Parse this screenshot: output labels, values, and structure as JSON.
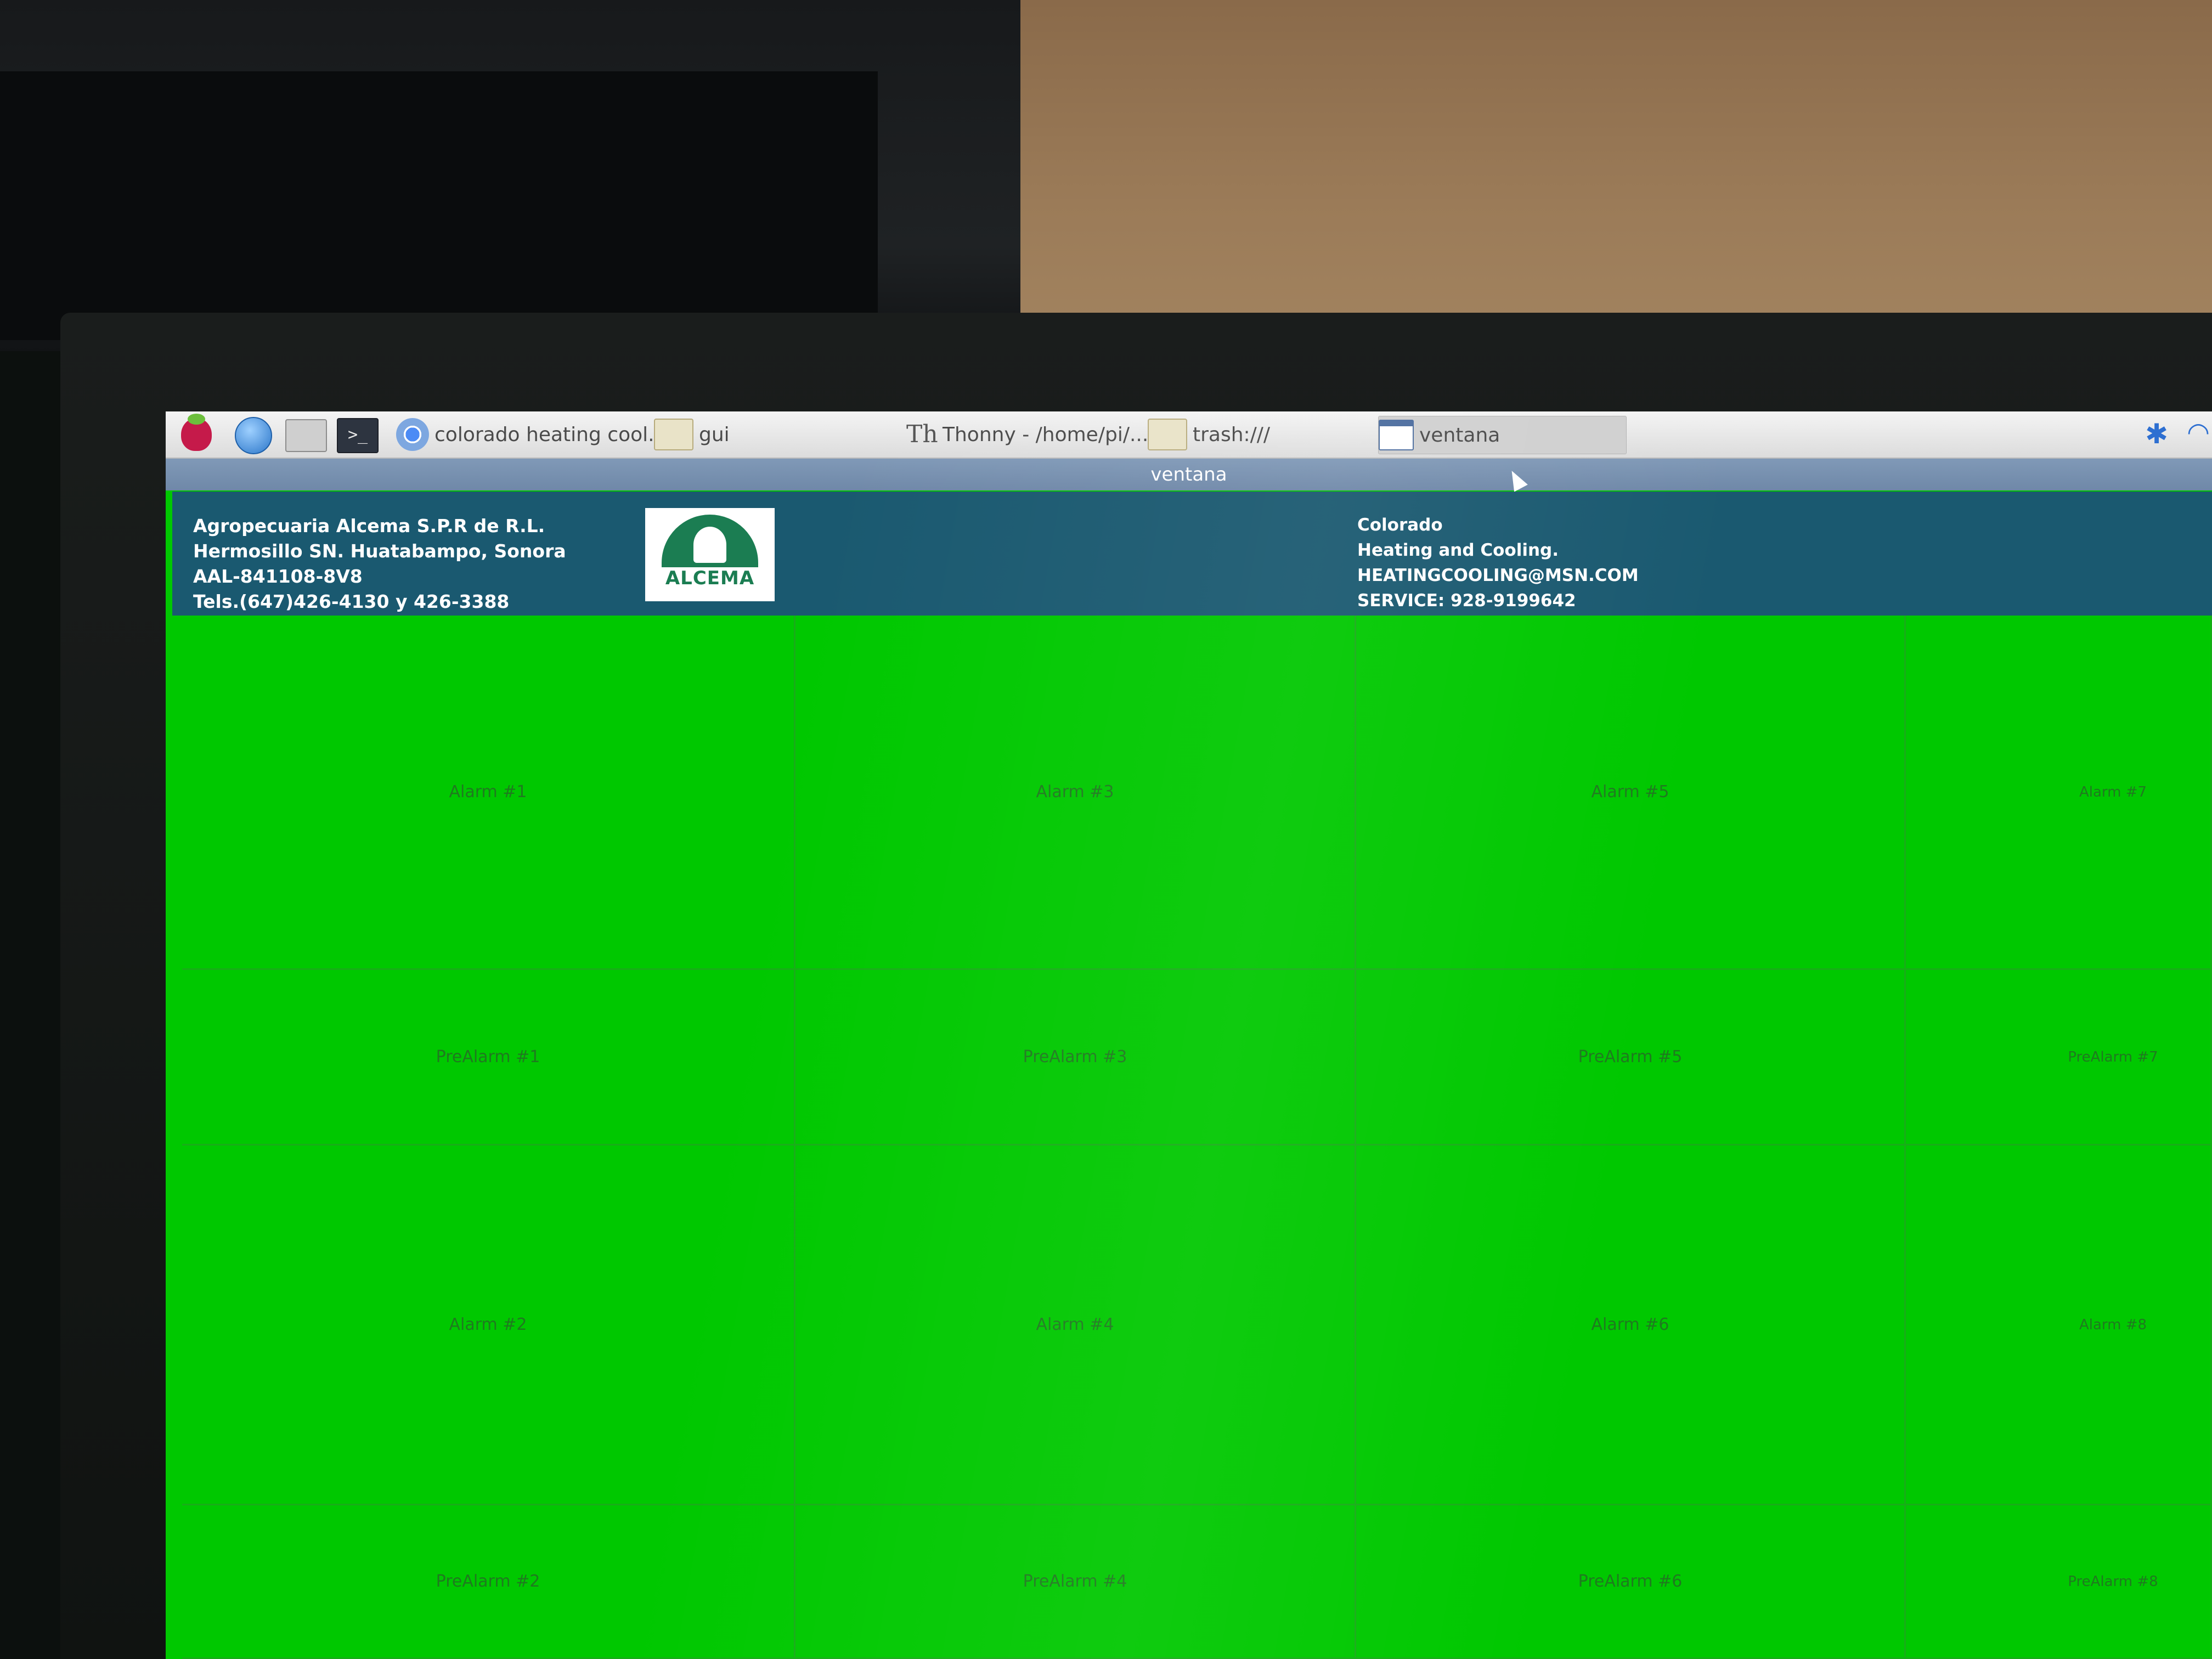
{
  "taskbar": {
    "items": [
      {
        "label": "colorado heating cool..."
      },
      {
        "label": "gui"
      },
      {
        "label": "Thonny  -  /home/pi/..."
      },
      {
        "label": "trash:///"
      },
      {
        "label": "ventana"
      }
    ]
  },
  "window": {
    "title": "ventana"
  },
  "header": {
    "company": [
      "Agropecuaria Alcema S.P.R de R.L.",
      "Hermosillo SN. Huatabampo, Sonora",
      "AAL-841108-8V8",
      "Tels.(647)426-4130 y 426-3388"
    ],
    "logo_text": "ALCEMA",
    "contact": [
      "Colorado",
      "Heating and Cooling.",
      "HEATINGCOOLING@MSN.COM",
      "SERVICE: 928-9199642"
    ]
  },
  "grid": {
    "cell_color": "#00c800",
    "rows": [
      [
        "Alarm #1",
        "Alarm #3",
        "Alarm #5",
        "Alarm #7"
      ],
      [
        "PreAlarm #1",
        "PreAlarm #3",
        "PreAlarm #5",
        "PreAlarm #7"
      ],
      [
        "Alarm #2",
        "Alarm #4",
        "Alarm #6",
        "Alarm #8"
      ],
      [
        "PreAlarm #2",
        "PreAlarm #4",
        "PreAlarm #6",
        "PreAlarm #8"
      ]
    ]
  },
  "colors": {
    "header_bg": "#1a5970",
    "titlebar_bg": "#7890ae",
    "logo_green": "#1b7d52",
    "ok_green": "#00c800"
  }
}
